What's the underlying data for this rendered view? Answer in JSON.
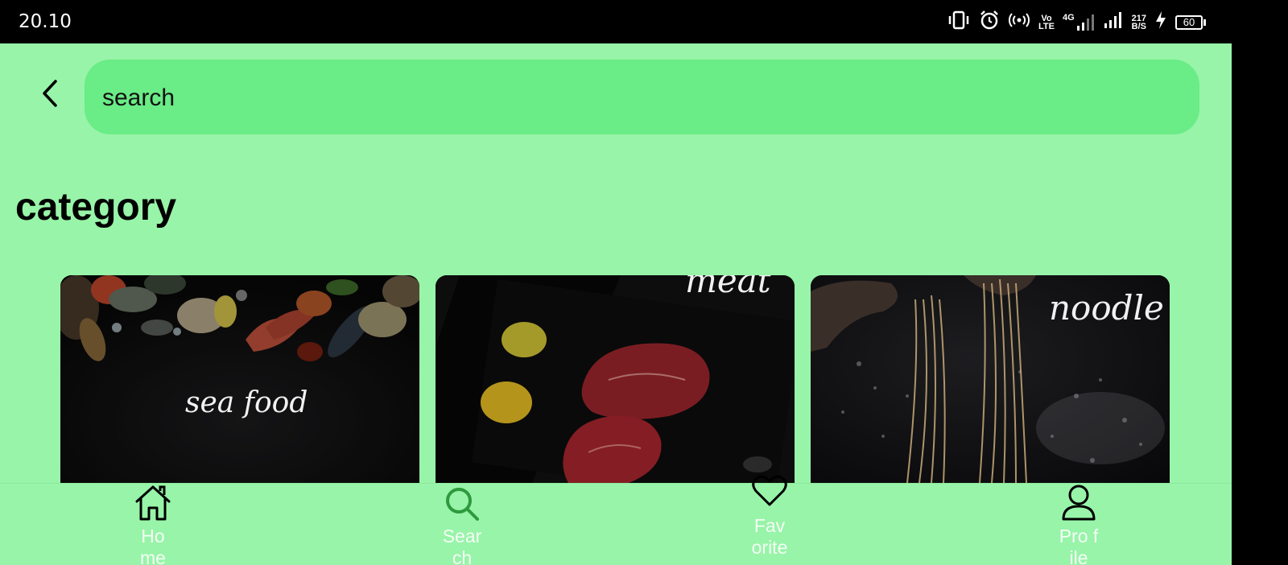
{
  "status_bar": {
    "time": "20.10",
    "volte_top": "Vo",
    "volte_bottom": "LTE",
    "network_type": "4G",
    "speed_value": "217",
    "speed_unit": "B/S",
    "battery_level": "60",
    "icons": [
      "vibrate-icon",
      "alarm-icon",
      "hotspot-icon",
      "volte-icon",
      "signal-4g-icon",
      "signal-icon",
      "charging-icon",
      "battery-icon"
    ]
  },
  "header": {
    "back_icon": "chevron-left-icon",
    "search_placeholder": "search"
  },
  "main": {
    "section_title": "category",
    "categories": [
      {
        "label": "sea food"
      },
      {
        "label": "meat"
      },
      {
        "label": "noodle"
      }
    ]
  },
  "bottom_nav": {
    "items": [
      {
        "label": "Home",
        "label_visible": "Ho me",
        "icon": "home-icon",
        "active": false
      },
      {
        "label": "Search",
        "label_visible": "Sear ch",
        "icon": "search-icon",
        "active": true
      },
      {
        "label": "Favorite",
        "label_visible": "Fav orite",
        "icon": "heart-icon",
        "active": false
      },
      {
        "label": "Profile",
        "label_visible": "Pro file",
        "icon": "person-icon",
        "active": false
      }
    ]
  },
  "colors": {
    "background": "#98f4a8",
    "search_bar": "#6aec86",
    "active_nav_icon": "#2e9a3e",
    "nav_label": "#f4fff6",
    "status_bar": "#000000"
  }
}
